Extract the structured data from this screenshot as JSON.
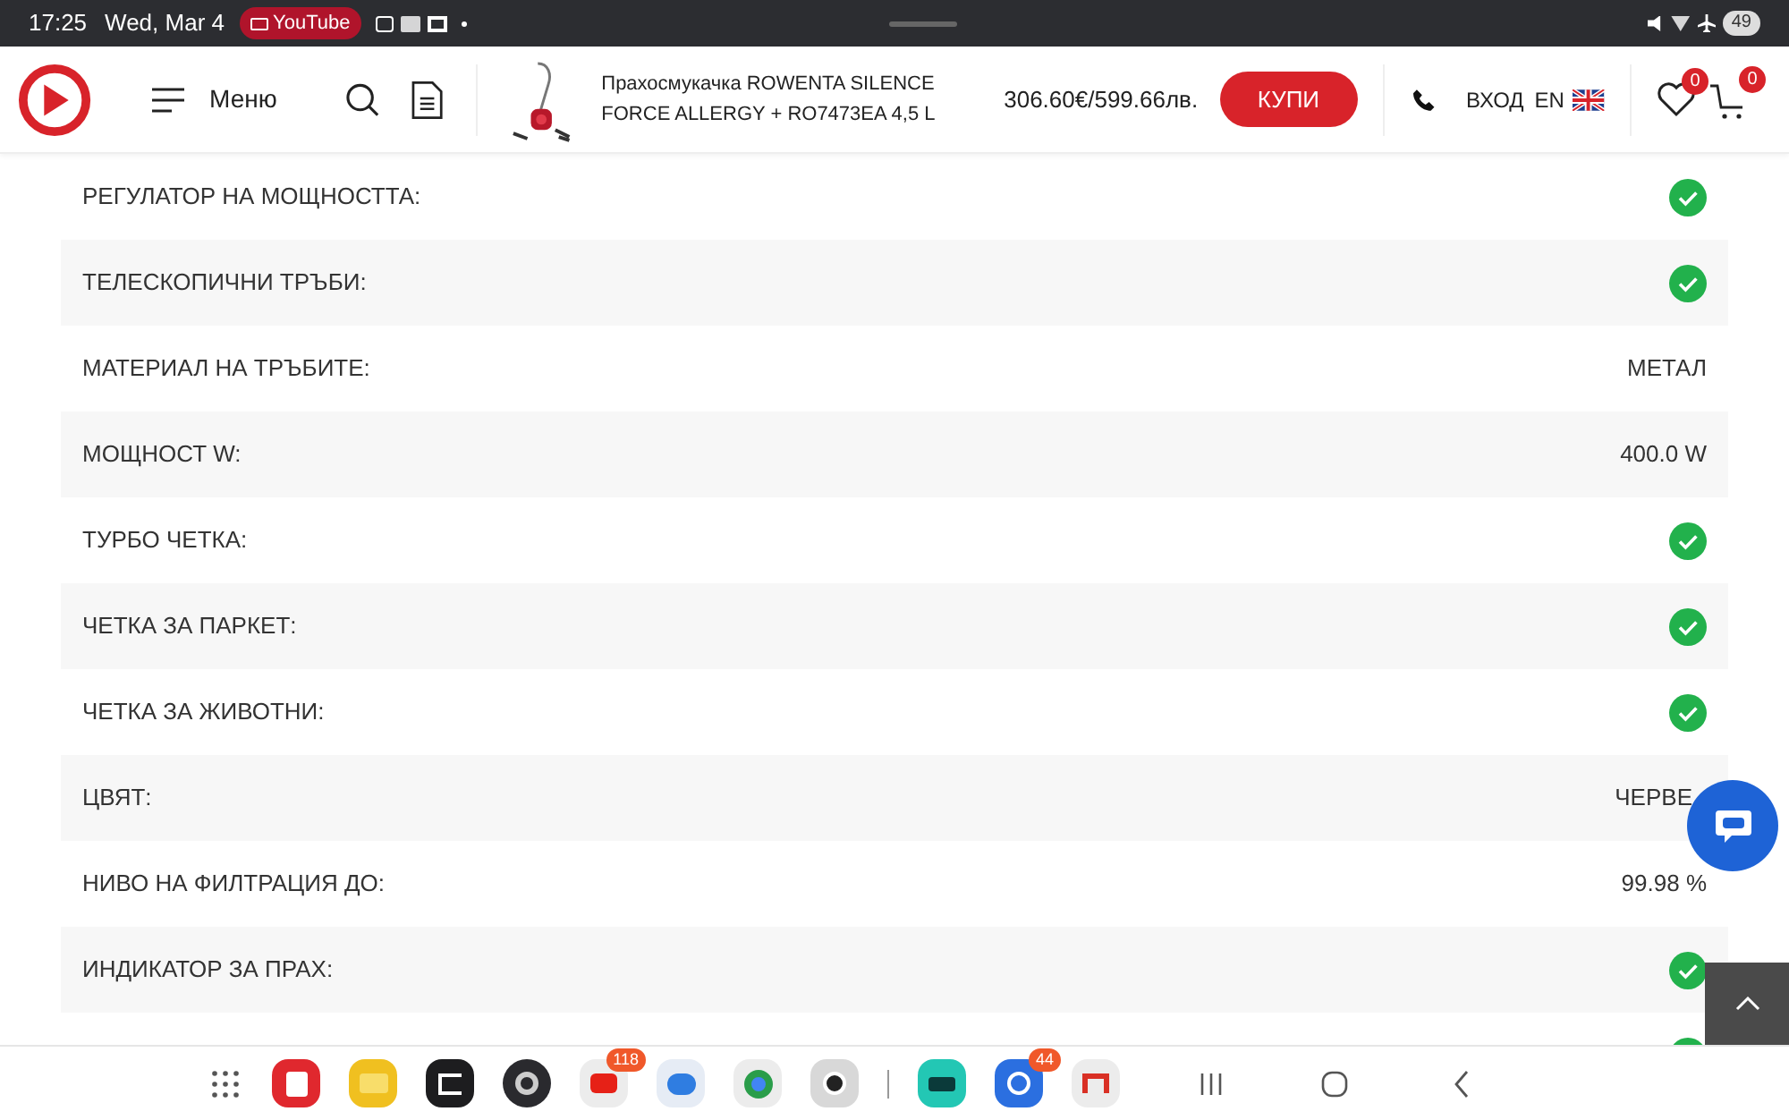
{
  "status_bar": {
    "time": "17:25",
    "date": "Wed, Mar 4",
    "app_chip": "YouTube",
    "battery": "49"
  },
  "header": {
    "menu_label": "Меню",
    "product_name": "Прахосмукачка ROWENTA SILENCE FORCE ALLERGY + RO7473EA 4,5 L",
    "price": "306.60€/599.66лв.",
    "buy_button": "КУПИ",
    "login": "ВХОД",
    "language": "EN",
    "wishlist_count": "0",
    "cart_count": "0"
  },
  "specs": [
    {
      "label": "РЕГУЛАТОР НА МОЩНОСТТА:",
      "kind": "check"
    },
    {
      "label": "ТЕЛЕСКОПИЧНИ ТРЪБИ:",
      "kind": "check"
    },
    {
      "label": "МАТЕРИАЛ НА ТРЪБИТЕ:",
      "kind": "text",
      "value": "МЕТАЛ"
    },
    {
      "label": "МОЩНОСТ W:",
      "kind": "text",
      "value": "400.0 W"
    },
    {
      "label": "ТУРБО ЧЕТКА:",
      "kind": "check"
    },
    {
      "label": "ЧЕТКА ЗА ПАРКЕТ:",
      "kind": "check"
    },
    {
      "label": "ЧЕТКА ЗА ЖИВОТНИ:",
      "kind": "check"
    },
    {
      "label": "ЦВЯТ:",
      "kind": "text",
      "value": "ЧЕРВЕ"
    },
    {
      "label": "НИВО НА ФИЛТРАЦИЯ ДО:",
      "kind": "text",
      "value": "99.98 %"
    },
    {
      "label": "ИНДИКАТОР ЗА ПРАХ:",
      "kind": "check"
    },
    {
      "kind": "check"
    }
  ],
  "dock": [
    {
      "kind": "notes"
    },
    {
      "kind": "files"
    },
    {
      "kind": "dark"
    },
    {
      "kind": "gear"
    },
    {
      "kind": "video",
      "badge": "118"
    },
    {
      "kind": "messages"
    },
    {
      "kind": "browser"
    },
    {
      "kind": "camera"
    },
    {
      "kind": "market"
    },
    {
      "kind": "share",
      "badge": "44"
    },
    {
      "kind": "mail"
    }
  ]
}
